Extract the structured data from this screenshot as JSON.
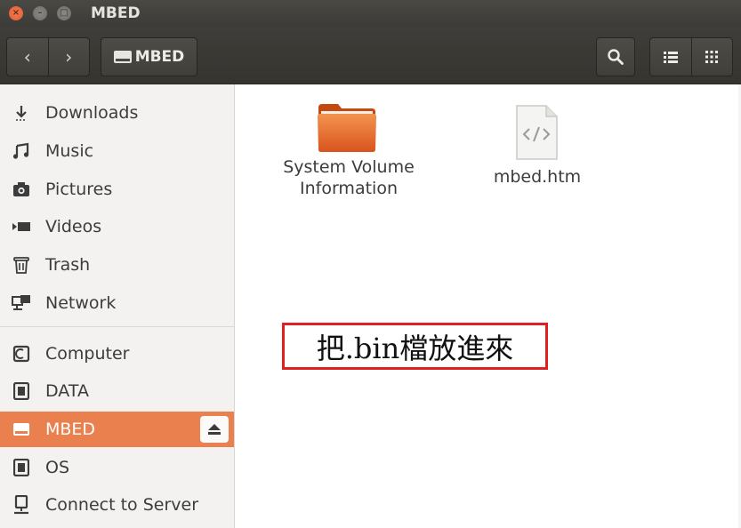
{
  "window": {
    "title": "MBED",
    "controls": {
      "close": "×",
      "minimize": "–",
      "maximize": "□"
    }
  },
  "toolbar": {
    "back_icon": "‹",
    "forward_icon": "›",
    "path_button_label": "MBED",
    "icons": [
      "chevron-left-icon",
      "chevron-right-icon",
      "drive-icon",
      "search-icon",
      "list-view-icon",
      "grid-view-icon"
    ]
  },
  "sidebar": {
    "items": [
      {
        "label": "Downloads",
        "icon": "download-icon"
      },
      {
        "label": "Music",
        "icon": "music-icon"
      },
      {
        "label": "Pictures",
        "icon": "camera-icon"
      },
      {
        "label": "Videos",
        "icon": "video-icon"
      },
      {
        "label": "Trash",
        "icon": "trash-icon"
      },
      {
        "label": "Network",
        "icon": "network-icon"
      },
      {
        "label": "Computer",
        "icon": "computer-icon"
      },
      {
        "label": "DATA",
        "icon": "drive-icon"
      },
      {
        "label": "MBED",
        "icon": "drive-icon",
        "active": true,
        "eject": true
      },
      {
        "label": "OS",
        "icon": "drive-icon"
      },
      {
        "label": "Connect to Server",
        "icon": "server-icon"
      }
    ],
    "active_color": "#e9804d"
  },
  "files": [
    {
      "name_line1": "System Volume",
      "name_line2": "Information",
      "type": "folder",
      "icon": "folder-icon"
    },
    {
      "name": "mbed.htm",
      "type": "html",
      "icon": "html-file-icon"
    }
  ],
  "annotation": {
    "text": "把.bin檔放進來",
    "border_color": "#e02020"
  }
}
